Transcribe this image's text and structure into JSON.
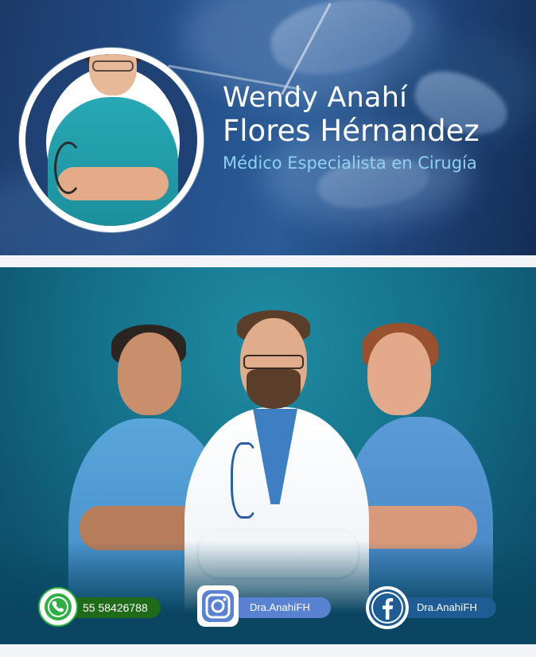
{
  "profile": {
    "name_line1": "Wendy Anahí",
    "name_line2": "Flores Hérnandez",
    "specialty": "Médico Especialista en Cirugía"
  },
  "contacts": {
    "whatsapp": {
      "icon": "whatsapp-icon",
      "label": "55 58426788",
      "color": "#1f6b19"
    },
    "instagram": {
      "icon": "instagram-icon",
      "label": "Dra.AnahíFH",
      "color": "#5a82d2"
    },
    "facebook": {
      "icon": "facebook-icon",
      "label": "Dra.AnahíFH",
      "color": "#1f5b94"
    }
  },
  "colors": {
    "header_bg": "#24508a",
    "team_bg": "#15718a",
    "accent_text": "#8dd2f3"
  }
}
